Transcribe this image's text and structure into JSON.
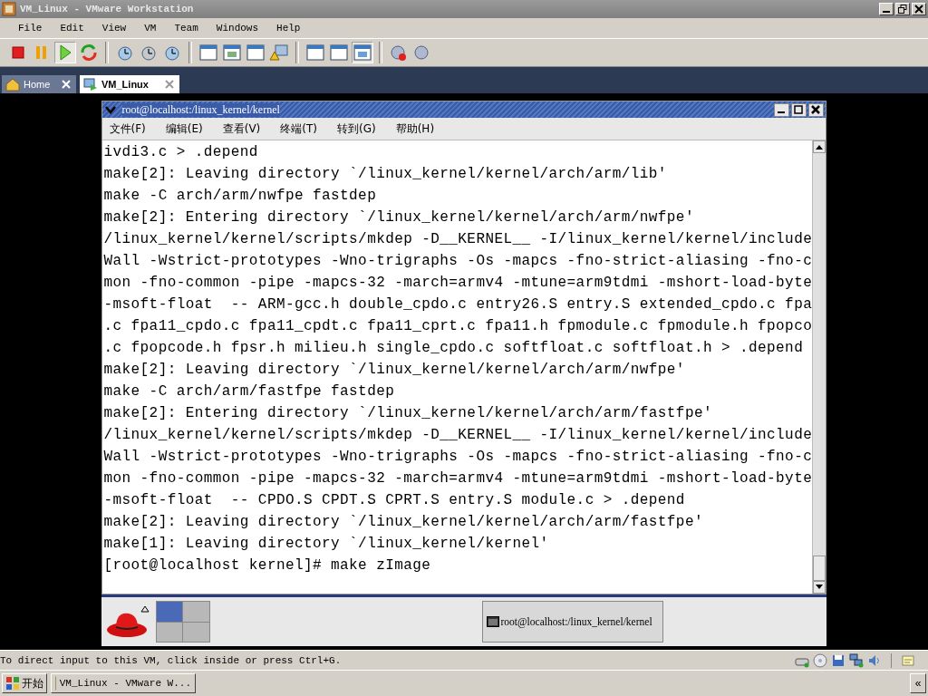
{
  "window": {
    "title": "VM_Linux - VMware Workstation"
  },
  "menu": [
    "File",
    "Edit",
    "View",
    "VM",
    "Team",
    "Windows",
    "Help"
  ],
  "toolbar": [
    {
      "kind": "stop",
      "pressed": false
    },
    {
      "kind": "pause",
      "pressed": false
    },
    {
      "kind": "play",
      "pressed": true
    },
    {
      "kind": "reset",
      "pressed": false
    },
    {
      "kind": "sep"
    },
    {
      "kind": "snap",
      "pressed": false
    },
    {
      "kind": "revert",
      "pressed": false
    },
    {
      "kind": "manager",
      "pressed": false
    },
    {
      "kind": "sep"
    },
    {
      "kind": "sidebar",
      "pressed": false
    },
    {
      "kind": "full",
      "pressed": false
    },
    {
      "kind": "quick",
      "pressed": false
    },
    {
      "kind": "warn",
      "pressed": false
    },
    {
      "kind": "sep"
    },
    {
      "kind": "settings",
      "pressed": false
    },
    {
      "kind": "console",
      "pressed": false
    },
    {
      "kind": "tabs",
      "pressed": true
    },
    {
      "kind": "sep"
    },
    {
      "kind": "record",
      "pressed": false
    },
    {
      "kind": "replay",
      "pressed": false
    }
  ],
  "tabs": [
    {
      "label": "Home",
      "selected": false
    },
    {
      "label": "VM_Linux",
      "selected": true
    }
  ],
  "terminal": {
    "title": "root@localhost:/linux_kernel/kernel",
    "menu": [
      "文件(F)",
      "编辑(E)",
      "查看(V)",
      "终端(T)",
      "转到(G)",
      "帮助(H)"
    ],
    "lines": [
      "ivdi3.c > .depend",
      "make[2]: Leaving directory `/linux_kernel/kernel/arch/arm/lib'",
      "make -C arch/arm/nwfpe fastdep",
      "make[2]: Entering directory `/linux_kernel/kernel/arch/arm/nwfpe'",
      "/linux_kernel/kernel/scripts/mkdep -D__KERNEL__ -I/linux_kernel/kernel/include",
      "Wall -Wstrict-prototypes -Wno-trigraphs -Os -mapcs -fno-strict-aliasing -fno-c",
      "mon -fno-common -pipe -mapcs-32 -march=armv4 -mtune=arm9tdmi -mshort-load-byte",
      "-msoft-float  -- ARM-gcc.h double_cpdo.c entry26.S entry.S extended_cpdo.c fpa",
      ".c fpa11_cpdo.c fpa11_cpdt.c fpa11_cprt.c fpa11.h fpmodule.c fpmodule.h fpopco",
      ".c fpopcode.h fpsr.h milieu.h single_cpdo.c softfloat.c softfloat.h > .depend",
      "make[2]: Leaving directory `/linux_kernel/kernel/arch/arm/nwfpe'",
      "make -C arch/arm/fastfpe fastdep",
      "make[2]: Entering directory `/linux_kernel/kernel/arch/arm/fastfpe'",
      "/linux_kernel/kernel/scripts/mkdep -D__KERNEL__ -I/linux_kernel/kernel/include",
      "Wall -Wstrict-prototypes -Wno-trigraphs -Os -mapcs -fno-strict-aliasing -fno-c",
      "mon -fno-common -pipe -mapcs-32 -march=armv4 -mtune=arm9tdmi -mshort-load-byte",
      "-msoft-float  -- CPDO.S CPDT.S CPRT.S entry.S module.c > .depend",
      "make[2]: Leaving directory `/linux_kernel/kernel/arch/arm/fastfpe'",
      "make[1]: Leaving directory `/linux_kernel/kernel'",
      "[root@localhost kernel]# make zImage"
    ]
  },
  "guest_panel": {
    "workspaces": [
      {
        "selected": true
      },
      {
        "selected": false
      },
      {
        "selected": false
      },
      {
        "selected": false
      }
    ],
    "task": "root@localhost:/linux_kernel/kernel"
  },
  "status_bar": {
    "text": "To direct input to this VM, click inside or press Ctrl+G."
  },
  "taskbar": {
    "start": "开始",
    "task": "VM_Linux - VMware W...",
    "collapse": "«"
  }
}
